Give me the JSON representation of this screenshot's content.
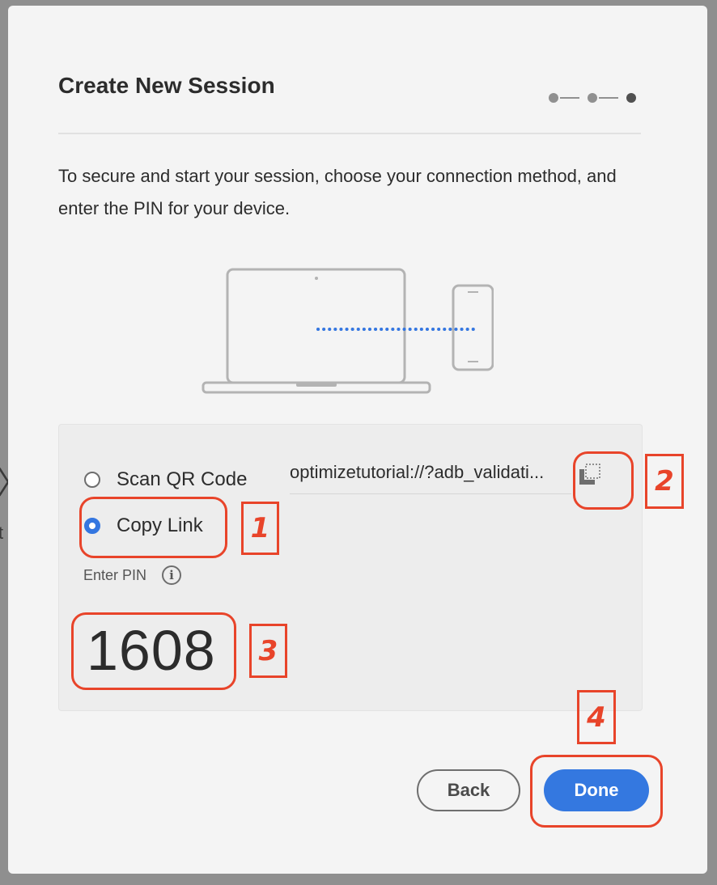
{
  "background": {
    "chevron": "〉",
    "fragment": "t"
  },
  "dialog": {
    "title": "Create New Session",
    "stepper": {
      "total_steps": 3,
      "current_step": 3
    },
    "description": "To secure and start your session, choose your connection method, and enter the PIN for your device."
  },
  "illustration": {
    "laptop_icon": "laptop-icon",
    "phone_icon": "phone-icon",
    "connection": "dotted-connection-line"
  },
  "connection": {
    "options": [
      {
        "label": "Scan QR Code",
        "selected": false
      },
      {
        "label": "Copy Link",
        "selected": true
      }
    ],
    "link_value": "optimizetutorial://?adb_validati...",
    "copy_icon": "copy-icon"
  },
  "pin": {
    "label": "Enter PIN",
    "info_icon": "i",
    "value": "1608"
  },
  "buttons": {
    "back": "Back",
    "done": "Done"
  },
  "annotations": {
    "one": "1",
    "two": "2",
    "three": "3",
    "four": "4",
    "color": "#e8442a"
  },
  "colors": {
    "accent": "#3478e0",
    "annotation": "#e8442a"
  }
}
